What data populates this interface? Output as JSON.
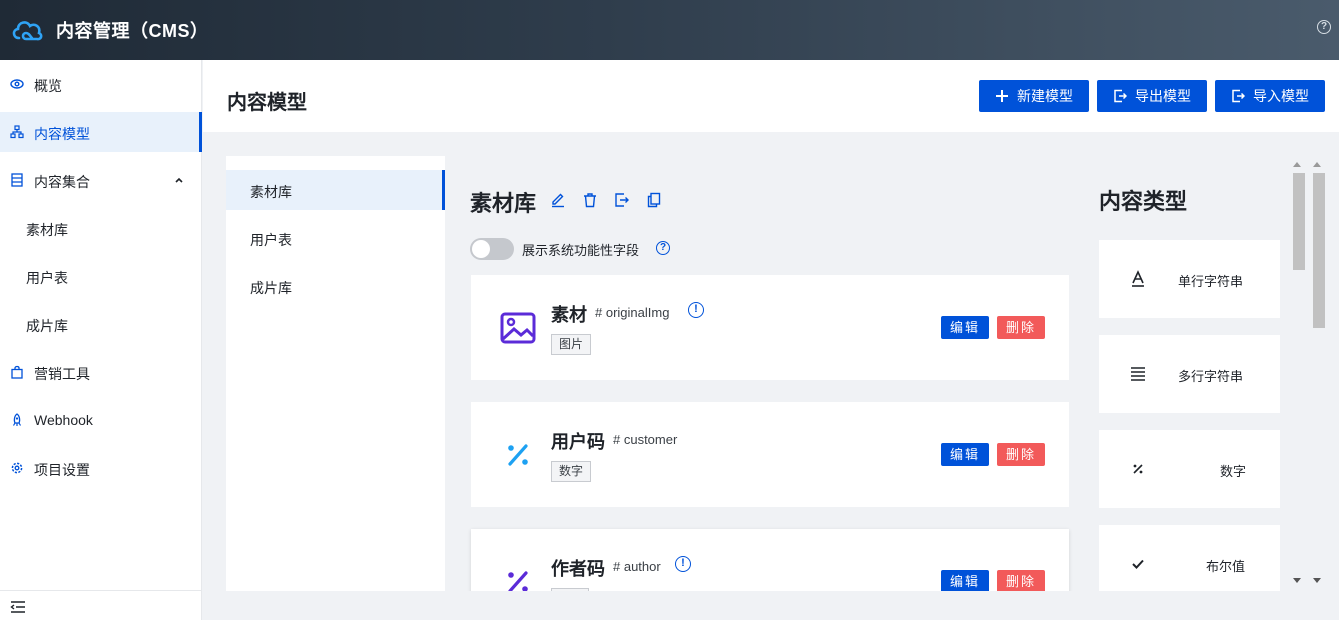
{
  "app": {
    "title": "内容管理（CMS）",
    "logo": "cloud-logo-icon",
    "help": "?"
  },
  "sidebar": {
    "items": [
      {
        "label": "概览",
        "icon": "eye-icon"
      },
      {
        "label": "内容模型",
        "icon": "sitemap-icon",
        "active": true
      },
      {
        "label": "内容集合",
        "icon": "table-icon",
        "expanded": true
      },
      {
        "label": "素材库"
      },
      {
        "label": "用户表"
      },
      {
        "label": "成片库"
      },
      {
        "label": "营销工具",
        "icon": "shopping-bag-icon"
      },
      {
        "label": "Webhook",
        "icon": "rocket-icon"
      },
      {
        "label": "项目设置",
        "icon": "gear-icon"
      }
    ],
    "collapse_icon": "collapse-menu-icon"
  },
  "header": {
    "title": "内容模型",
    "buttons": {
      "new": "新建模型",
      "export": "导出模型",
      "import": "导入模型"
    }
  },
  "model_list": {
    "items": [
      {
        "label": "素材库",
        "active": true
      },
      {
        "label": "用户表"
      },
      {
        "label": "成片库"
      }
    ]
  },
  "model": {
    "name": "素材库",
    "toggle_label": "展示系统功能性字段",
    "fields": [
      {
        "name": "素材",
        "id": "# originalImg",
        "tag": "图片",
        "icon": "image-icon",
        "info": true
      },
      {
        "name": "用户码",
        "id": "# customer",
        "tag": "数字",
        "icon": "percent-icon",
        "info": false
      },
      {
        "name": "作者码",
        "id": "# author",
        "tag": "",
        "icon": "percent-icon",
        "info": true
      }
    ],
    "edit_label": "编辑",
    "delete_label": "删除"
  },
  "content_types": {
    "title": "内容类型",
    "items": [
      {
        "label": "单行字符串",
        "icon": "text-a-icon"
      },
      {
        "label": "多行字符串",
        "icon": "lines-icon"
      },
      {
        "label": "数字",
        "icon": "percent-icon"
      },
      {
        "label": "布尔值",
        "icon": "check-icon"
      }
    ]
  },
  "colors": {
    "primary": "#0052d9",
    "danger": "#f25a5a",
    "image_icon": "#5b2bd8",
    "percent_icon": "#1da1f2"
  }
}
